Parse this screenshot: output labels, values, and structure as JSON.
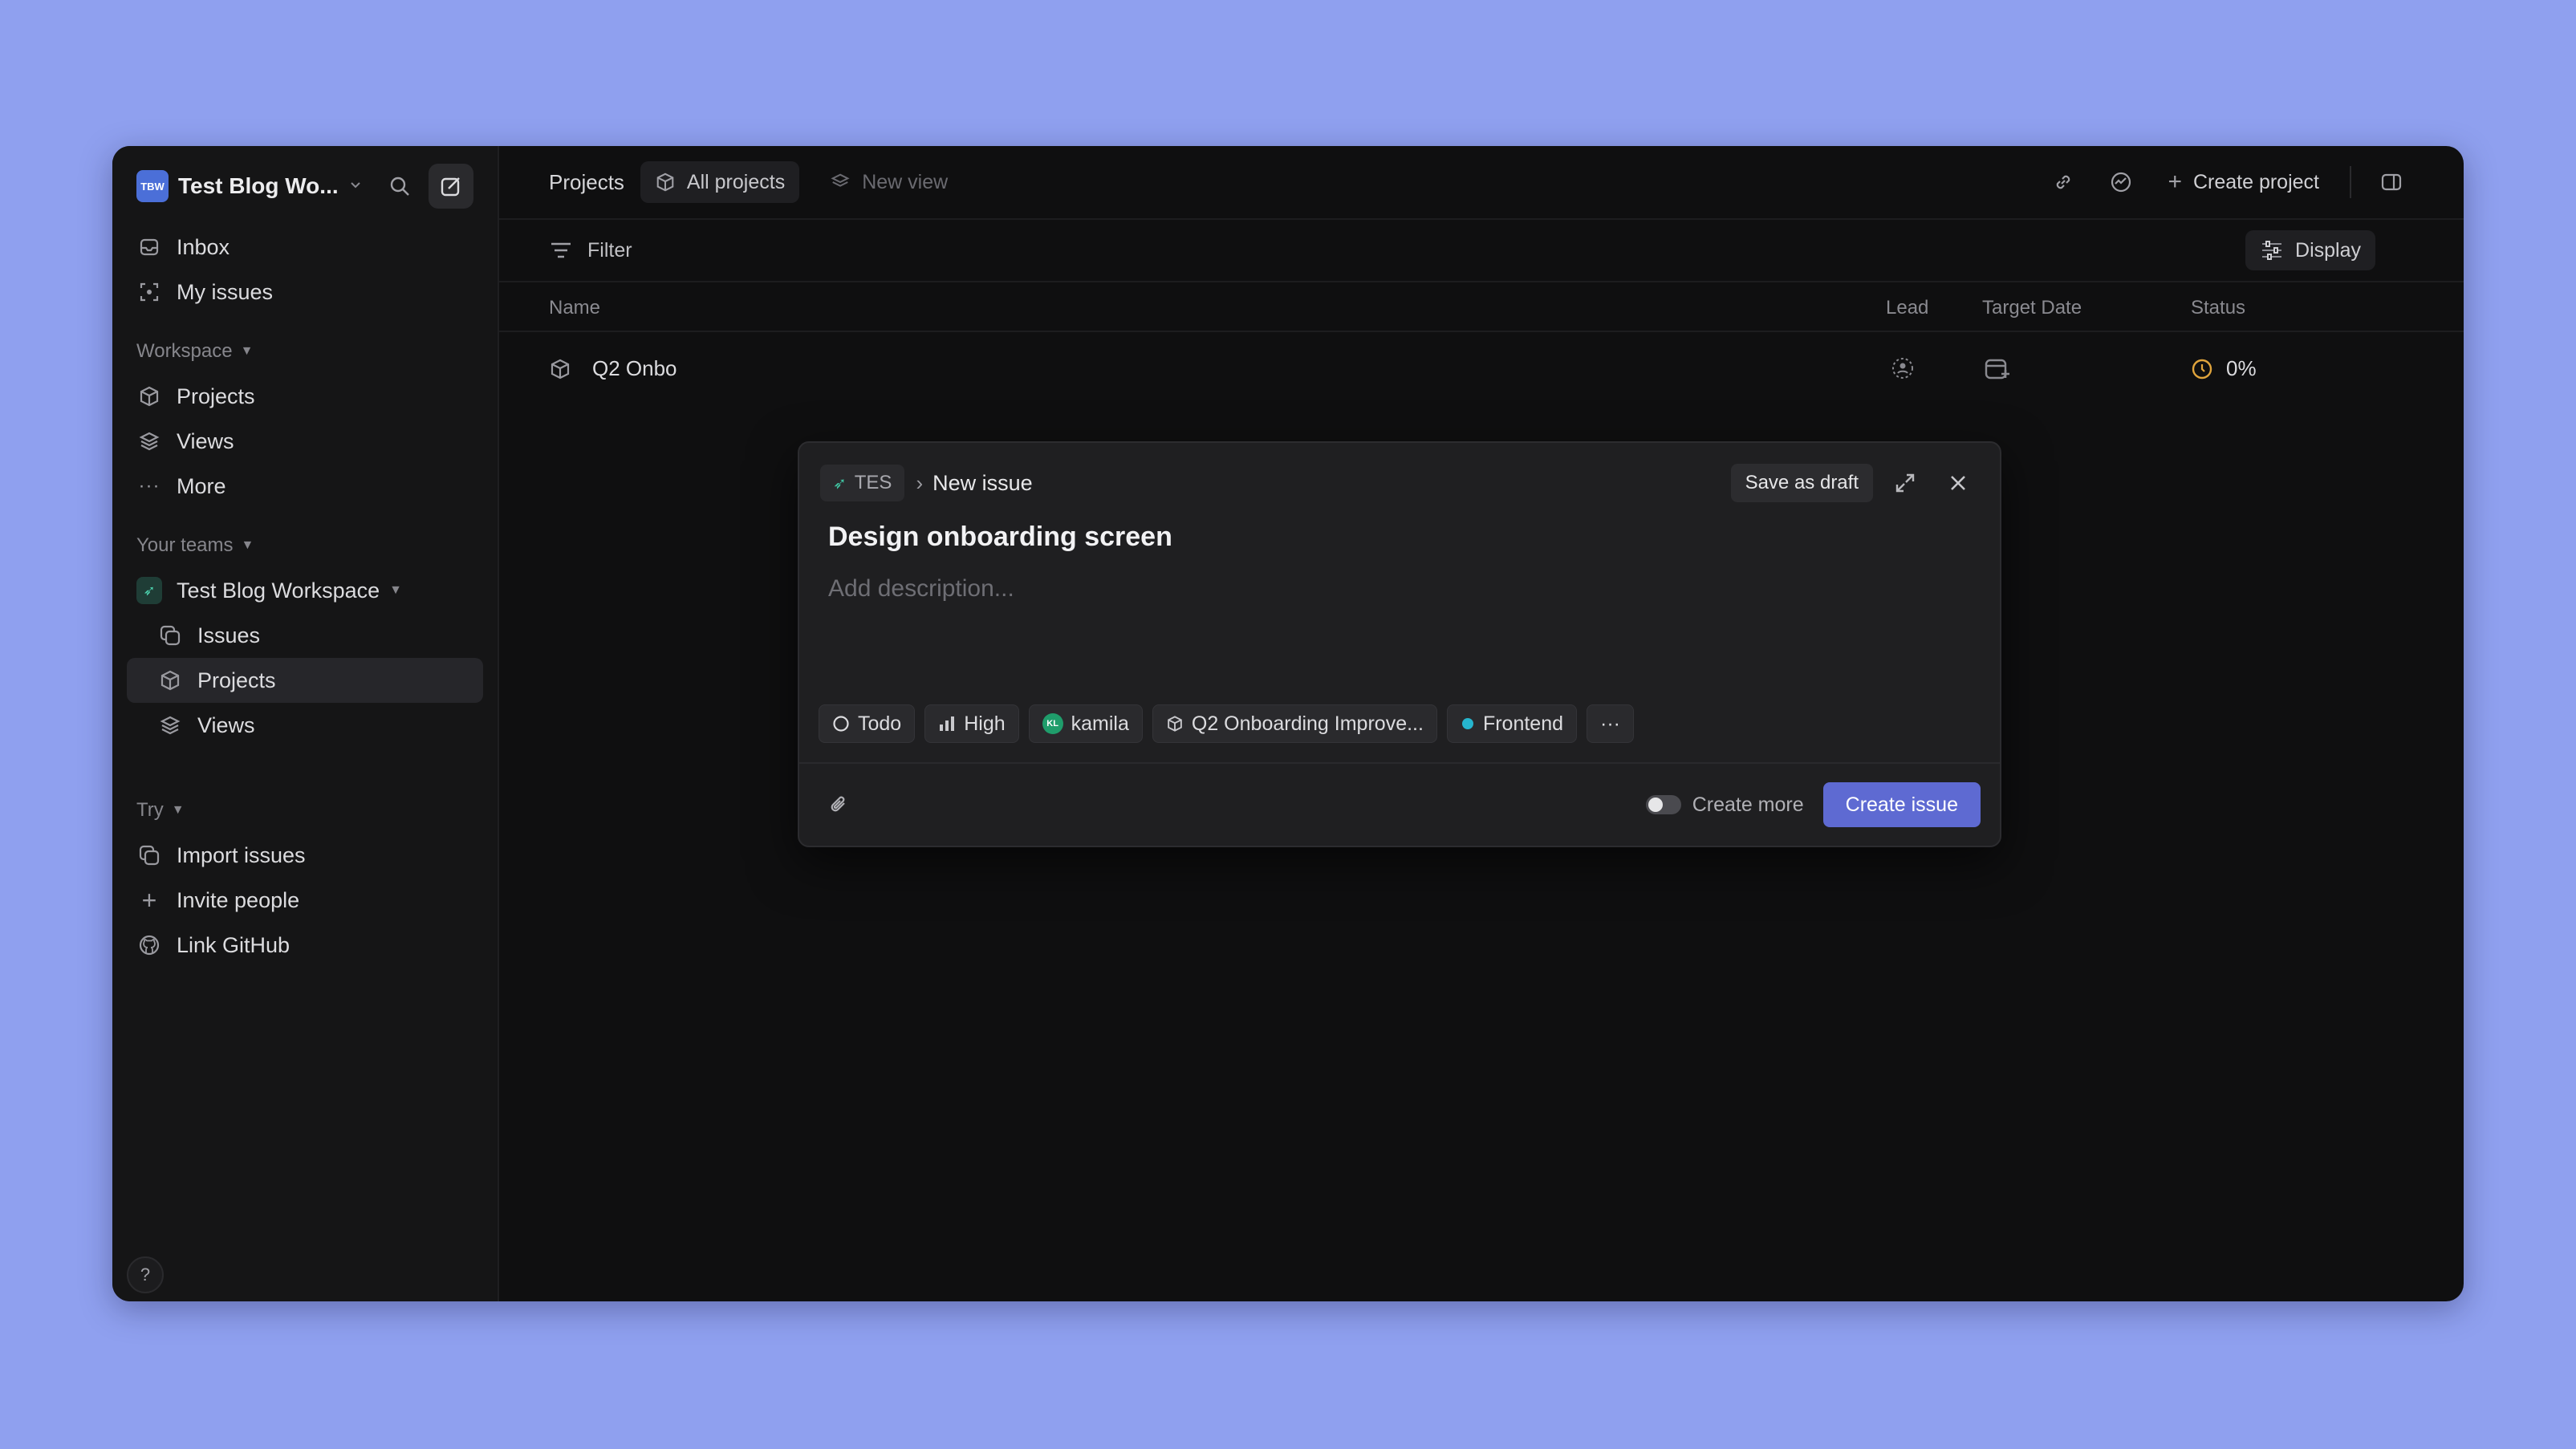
{
  "sidebar": {
    "workspace": {
      "logo_text": "TBW",
      "name": "Test Blog Wo..."
    },
    "primary_items": [
      {
        "label": "Inbox"
      },
      {
        "label": "My issues"
      }
    ],
    "workspace_section": {
      "label": "Workspace",
      "items": [
        {
          "label": "Projects"
        },
        {
          "label": "Views"
        },
        {
          "label": "More"
        }
      ]
    },
    "teams_section": {
      "label": "Your teams",
      "team_name": "Test Blog Workspace",
      "items": [
        {
          "label": "Issues"
        },
        {
          "label": "Projects"
        },
        {
          "label": "Views"
        }
      ]
    },
    "try_section": {
      "label": "Try",
      "items": [
        {
          "label": "Import issues"
        },
        {
          "label": "Invite people"
        },
        {
          "label": "Link GitHub"
        }
      ]
    },
    "help_label": "?"
  },
  "topbar": {
    "title": "Projects",
    "tabs": [
      {
        "label": "All projects"
      },
      {
        "label": "New view"
      }
    ],
    "create_project_label": "Create project"
  },
  "filterbar": {
    "filter_label": "Filter",
    "display_label": "Display"
  },
  "table": {
    "headers": {
      "name": "Name",
      "lead": "Lead",
      "target_date": "Target Date",
      "status": "Status"
    },
    "rows": [
      {
        "name": "Q2 Onbo",
        "status_progress": "0%"
      }
    ]
  },
  "modal": {
    "team_key": "TES",
    "breadcrumb": "New issue",
    "save_draft_label": "Save as draft",
    "title": "Design onboarding screen",
    "description_placeholder": "Add description...",
    "chips": {
      "status": "Todo",
      "priority": "High",
      "assignee_initials": "KL",
      "assignee": "kamila",
      "project": "Q2 Onboarding Improve...",
      "label": "Frontend",
      "more": "···"
    },
    "create_more_label": "Create more",
    "create_more_enabled": false,
    "create_button_label": "Create issue"
  },
  "colors": {
    "background": "#8fa0ef",
    "accent": "#5e6ad2",
    "status_ring": "#e0a43c",
    "label_dot": "#26b5ce",
    "assignee_avatar": "#1f9d6b"
  }
}
